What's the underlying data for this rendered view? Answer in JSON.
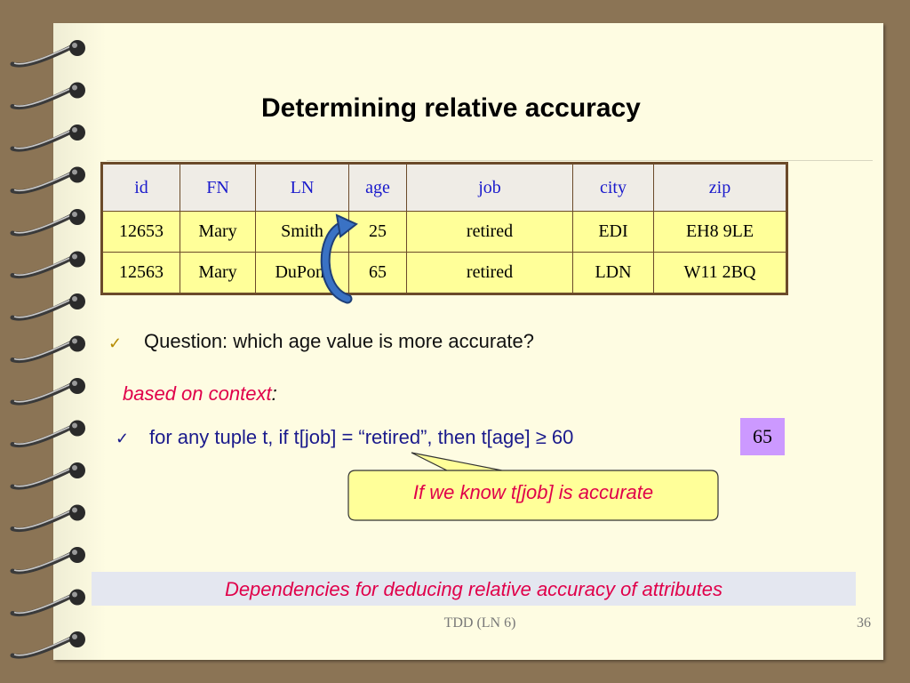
{
  "slide": {
    "title": "Determining relative accuracy",
    "footer": "TDD (LN 6)",
    "number": "36"
  },
  "table": {
    "headers": [
      "id",
      "FN",
      "LN",
      "age",
      "job",
      "city",
      "zip"
    ],
    "rows": [
      [
        "12653",
        "Mary",
        "Smith",
        "25",
        "retired",
        "EDI",
        "EH8 9LE"
      ],
      [
        "12563",
        "Mary",
        "DuPont",
        "65",
        "retired",
        "LDN",
        "W11 2BQ"
      ]
    ]
  },
  "bullets": {
    "question": "Question: which age value is more accurate?",
    "context": "based on context",
    "context_colon": ":",
    "rule": "for any tuple t, if t[job] = “retired”, then t[age] ≥ 60",
    "value": "65"
  },
  "callout": "If we know t[job] is accurate",
  "conclusion": "Dependencies for deducing relative accuracy of attributes",
  "colors": {
    "background": "#8b7455",
    "page": "#fefce2",
    "header_text": "#1a1acc",
    "cell_fill": "#ffff99",
    "highlight": "#e0004a",
    "value_box": "#cc99ff"
  },
  "icons": [
    "spiral-binding-icon",
    "curved-arrow-icon",
    "checkmark-icon"
  ]
}
